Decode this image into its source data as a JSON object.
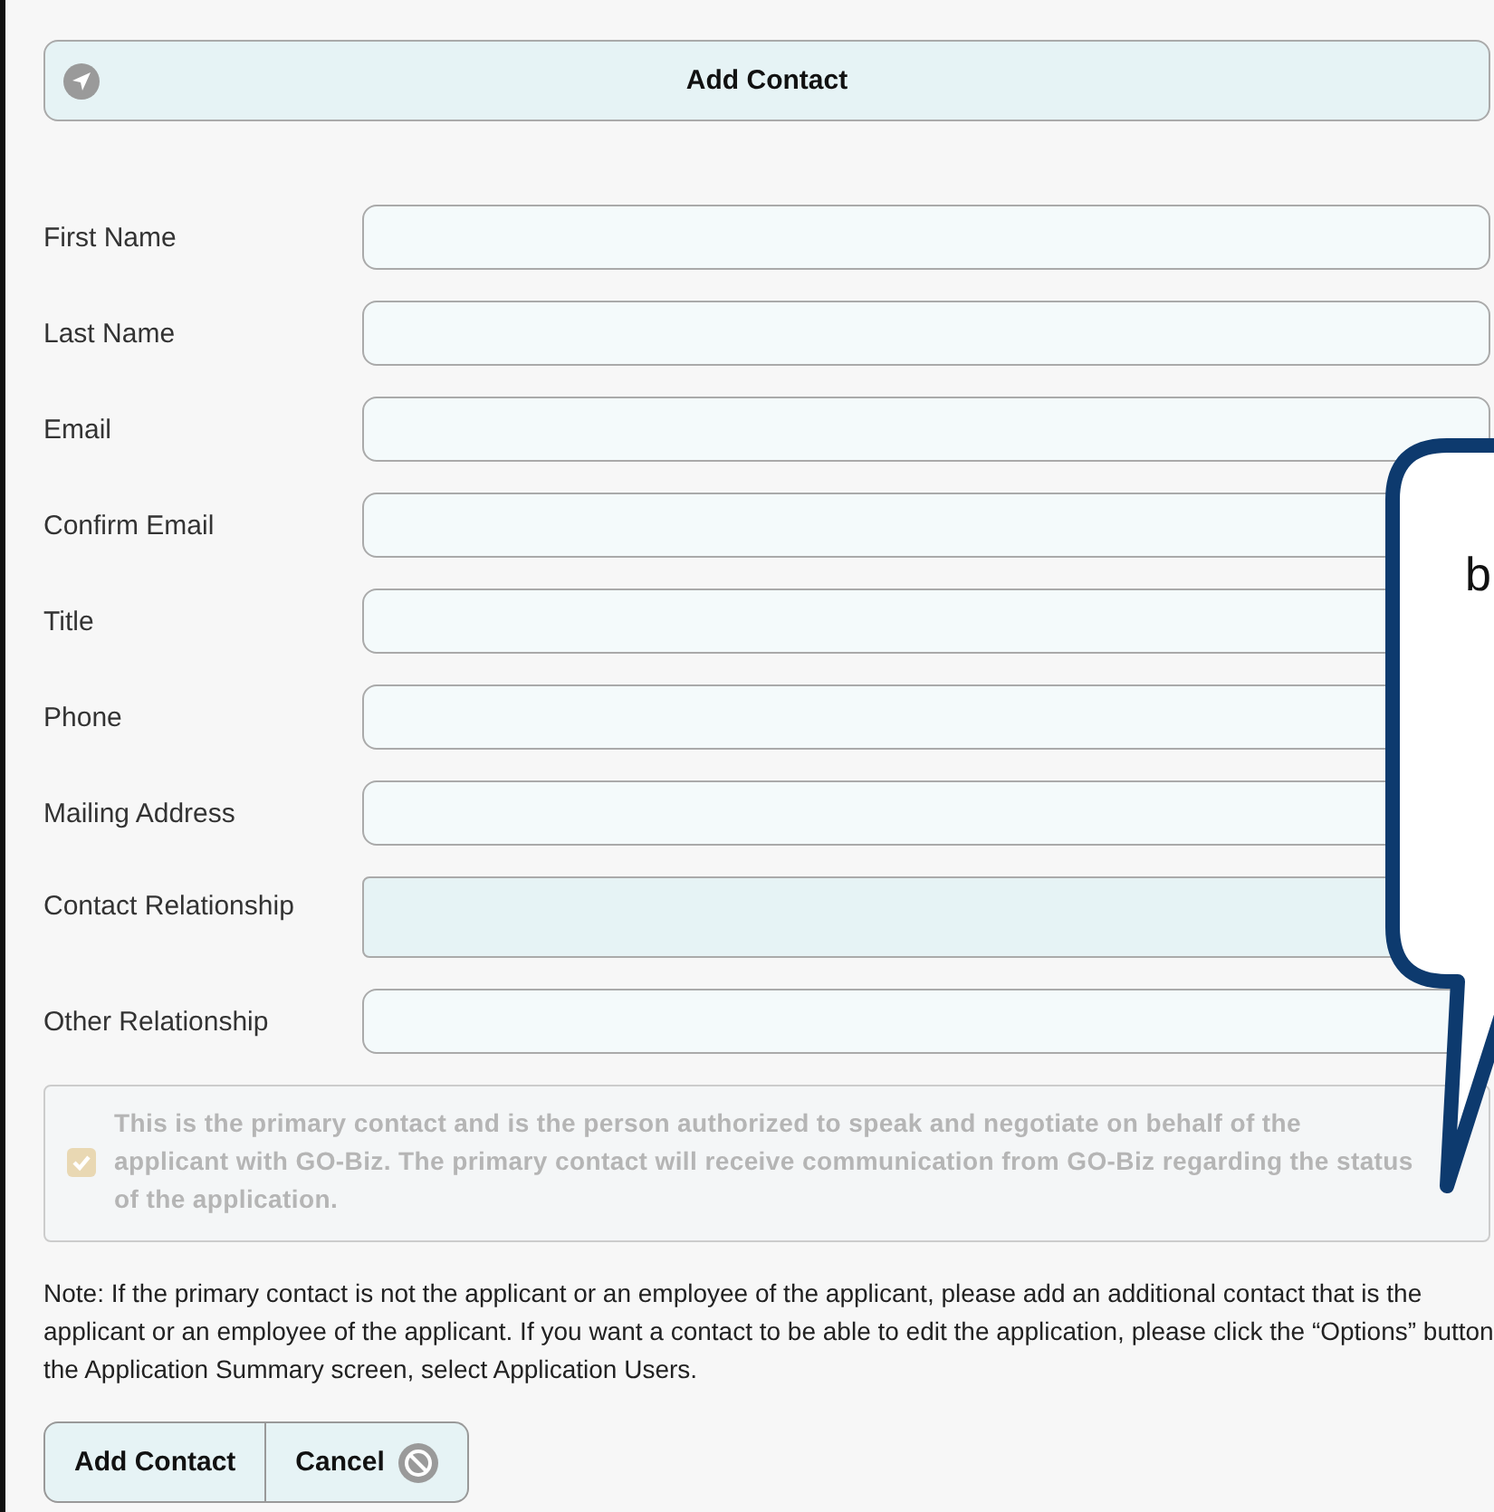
{
  "header": {
    "title": "Add Contact"
  },
  "fields": [
    {
      "label": "First Name",
      "kind": "text"
    },
    {
      "label": "Last Name",
      "kind": "text"
    },
    {
      "label": "Email",
      "kind": "text"
    },
    {
      "label": "Confirm Email",
      "kind": "text"
    },
    {
      "label": "Title",
      "kind": "text"
    },
    {
      "label": "Phone",
      "kind": "text"
    },
    {
      "label": "Mailing Address",
      "kind": "text"
    },
    {
      "label": "Contact Relationship",
      "kind": "select"
    },
    {
      "label": "Other Relationship",
      "kind": "text"
    }
  ],
  "primary_contact": {
    "checked": true,
    "disabled": true,
    "text": "This is the primary contact and is the person authorized to speak and negotiate on behalf of the applicant with GO-Biz. The primary contact will receive communication from GO-Biz regarding the status of the application."
  },
  "note": "Note: If the primary contact is not the applicant or an employee of the applicant, please add an additional contact that is the applicant or an employee of the applicant. If you want a contact to be able to edit the application, please click the “Options” button the Application Summary screen, select Application Users.",
  "buttons": [
    {
      "label": "Add Contact",
      "kind": "submit"
    },
    {
      "label": "Cancel",
      "kind": "cancel"
    }
  ],
  "callout": {
    "lines": [
      "b"
    ]
  }
}
